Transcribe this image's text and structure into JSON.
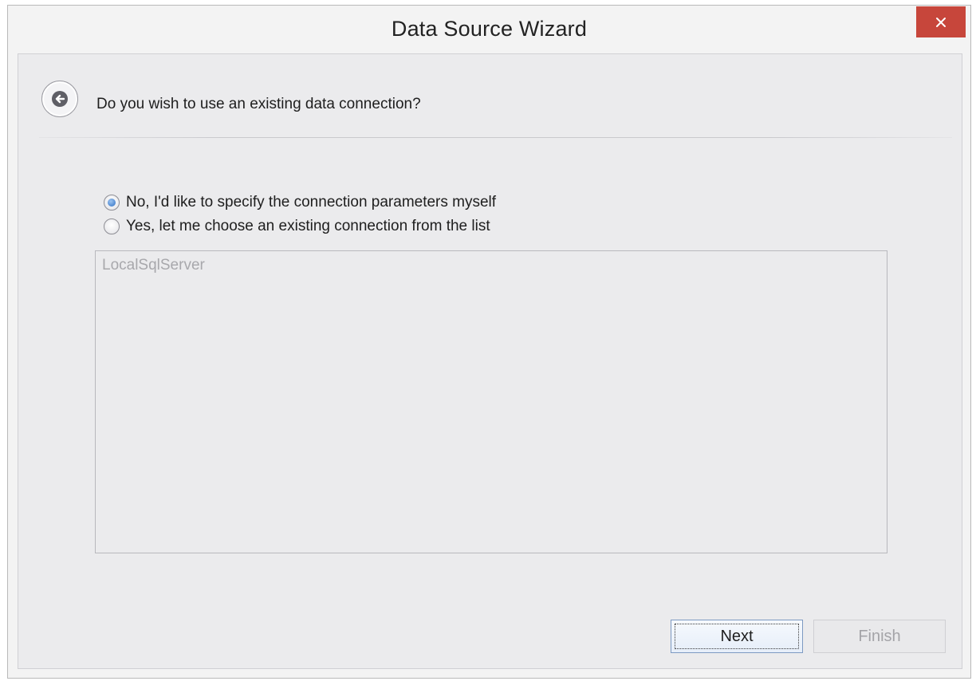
{
  "window": {
    "title": "Data Source Wizard"
  },
  "header": {
    "question": "Do you wish to use an existing data connection?"
  },
  "options": [
    {
      "label": "No, I'd like to specify the connection parameters myself",
      "checked": true
    },
    {
      "label": "Yes, let me choose an existing connection from the list",
      "checked": false
    }
  ],
  "connections": {
    "items": [
      "LocalSqlServer"
    ],
    "enabled": false
  },
  "buttons": {
    "next": "Next",
    "finish": "Finish"
  },
  "colors": {
    "close_button": "#c7463b",
    "radio_selected": "#2f6fc4"
  },
  "icons": {
    "back": "back-arrow-icon",
    "close": "close-icon"
  }
}
